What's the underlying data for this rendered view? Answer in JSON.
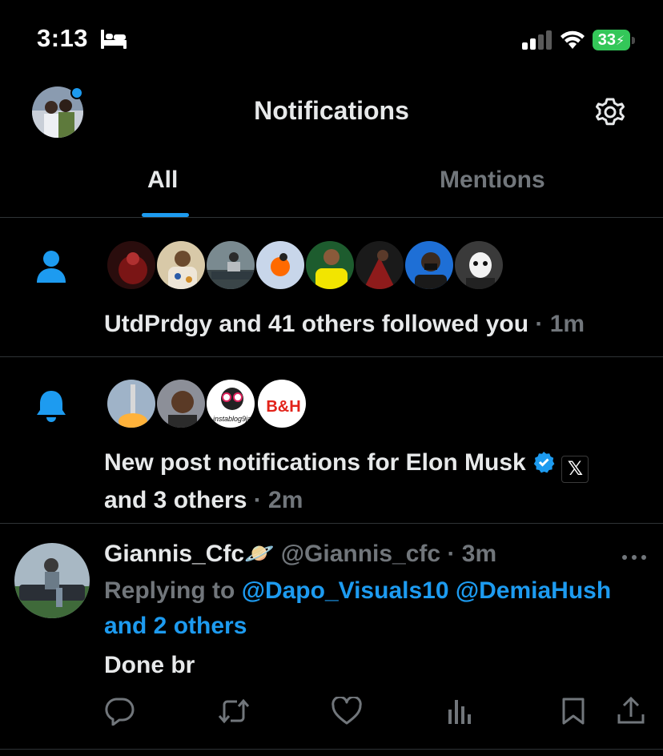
{
  "status_bar": {
    "time": "3:13",
    "battery": "33",
    "icons": [
      "bed-icon",
      "signal-icon",
      "wifi-icon",
      "battery-icon"
    ]
  },
  "header": {
    "title": "Notifications",
    "icons": [
      "avatar",
      "gear-icon"
    ]
  },
  "tabs": [
    {
      "label": "All",
      "active": true
    },
    {
      "label": "Mentions",
      "active": false
    }
  ],
  "colors": {
    "accent": "#1d9bf0",
    "muted": "#71767b",
    "text": "#e7e9ea",
    "background": "#000000",
    "divider": "#2f3336"
  },
  "notifications": [
    {
      "type": "follow",
      "icon": "person-icon",
      "text": "UtdPrdgy and 41 others followed you",
      "time": "· 1m"
    },
    {
      "type": "new-post",
      "icon": "bell-icon",
      "text_line1": "New post notifications for Elon Musk",
      "text_line2": "and 3 others",
      "time": "· 2m",
      "avatar_labels": [
        "instablog9ja",
        "B&H"
      ],
      "badge": "𝕏"
    }
  ],
  "tweet": {
    "name": "Giannis_Cfc",
    "emoji": "🪐",
    "handle": "@Giannis_cfc",
    "time": "· 3m",
    "replying_to_prefix": "Replying to",
    "mention_1": "@Dapo_Visuals10",
    "mention_2": "@DemiaHush",
    "mention_others": "and 2 others",
    "body": "Done br",
    "actions": [
      "reply-icon",
      "retweet-icon",
      "like-icon",
      "views-icon",
      "bookmark-icon",
      "share-icon"
    ]
  }
}
